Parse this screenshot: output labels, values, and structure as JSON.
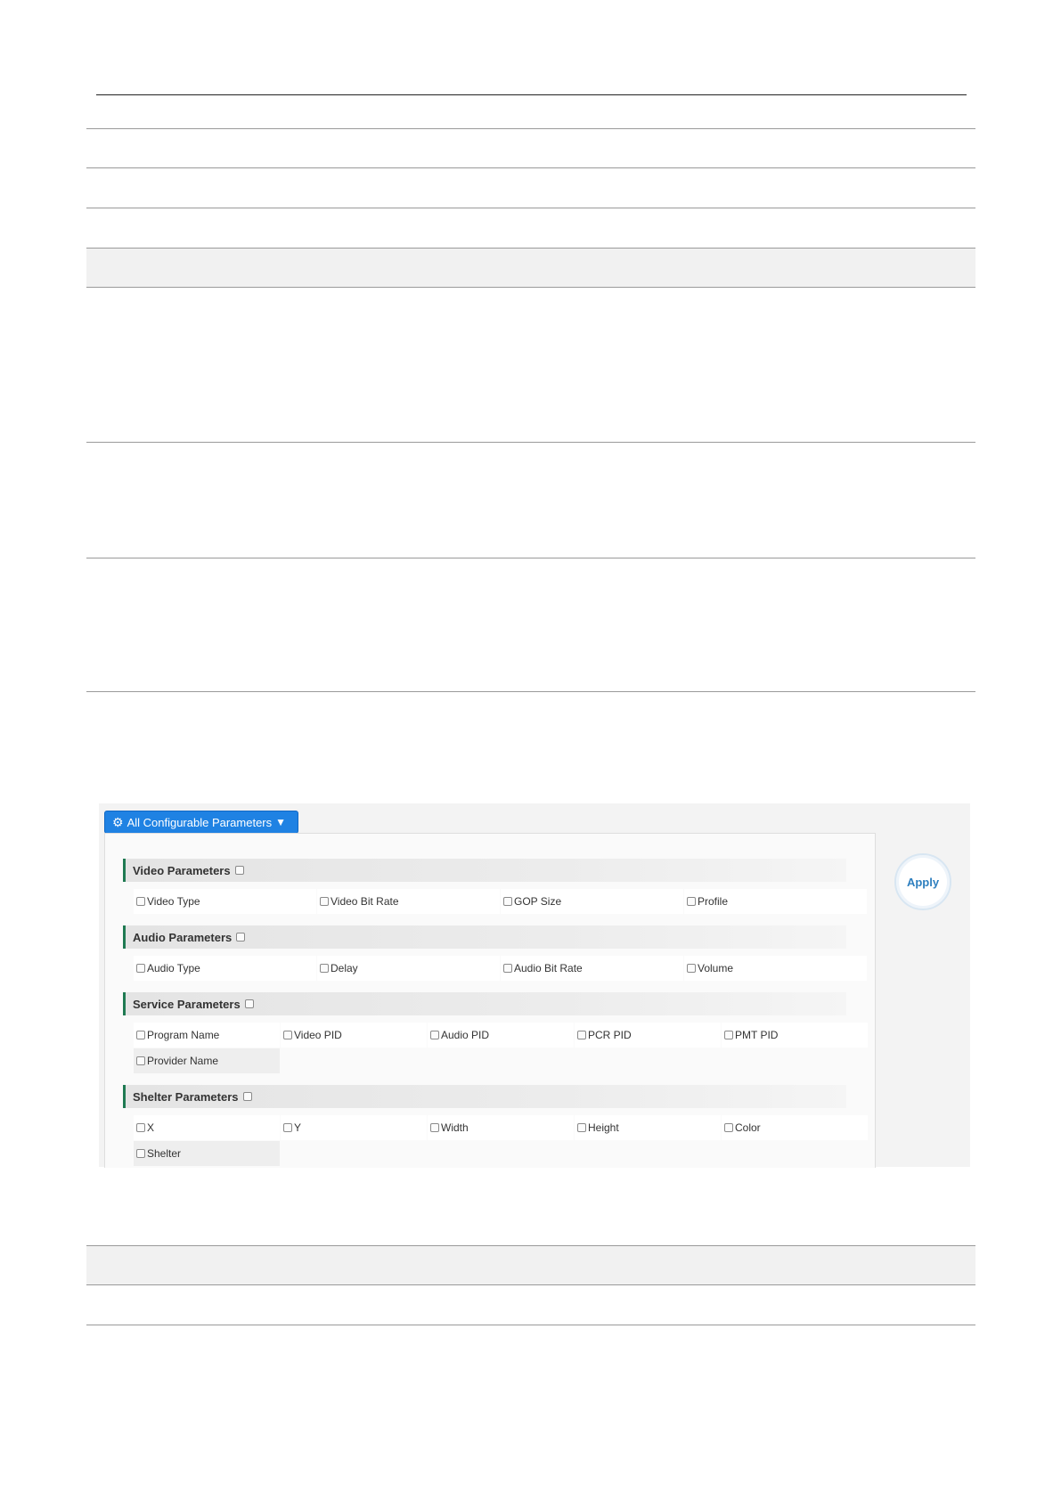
{
  "toolbar": {
    "config_label": "All Configurable Parameters",
    "apply_label": "Apply"
  },
  "sections": [
    {
      "title": "Video Parameters",
      "rows": [
        [
          "Video Type",
          "Video Bit Rate",
          "GOP Size",
          "Profile"
        ]
      ]
    },
    {
      "title": "Audio Parameters",
      "rows": [
        [
          "Audio Type",
          "Delay",
          "Audio Bit Rate",
          "Volume"
        ]
      ]
    },
    {
      "title": "Service Parameters",
      "rows": [
        [
          "Program Name",
          "Video PID",
          "Audio PID",
          "PCR PID",
          "PMT PID"
        ],
        [
          "Provider Name"
        ]
      ]
    },
    {
      "title": "Shelter Parameters",
      "rows": [
        [
          "X",
          "Y",
          "Width",
          "Height",
          "Color"
        ],
        [
          "Shelter"
        ]
      ]
    }
  ]
}
